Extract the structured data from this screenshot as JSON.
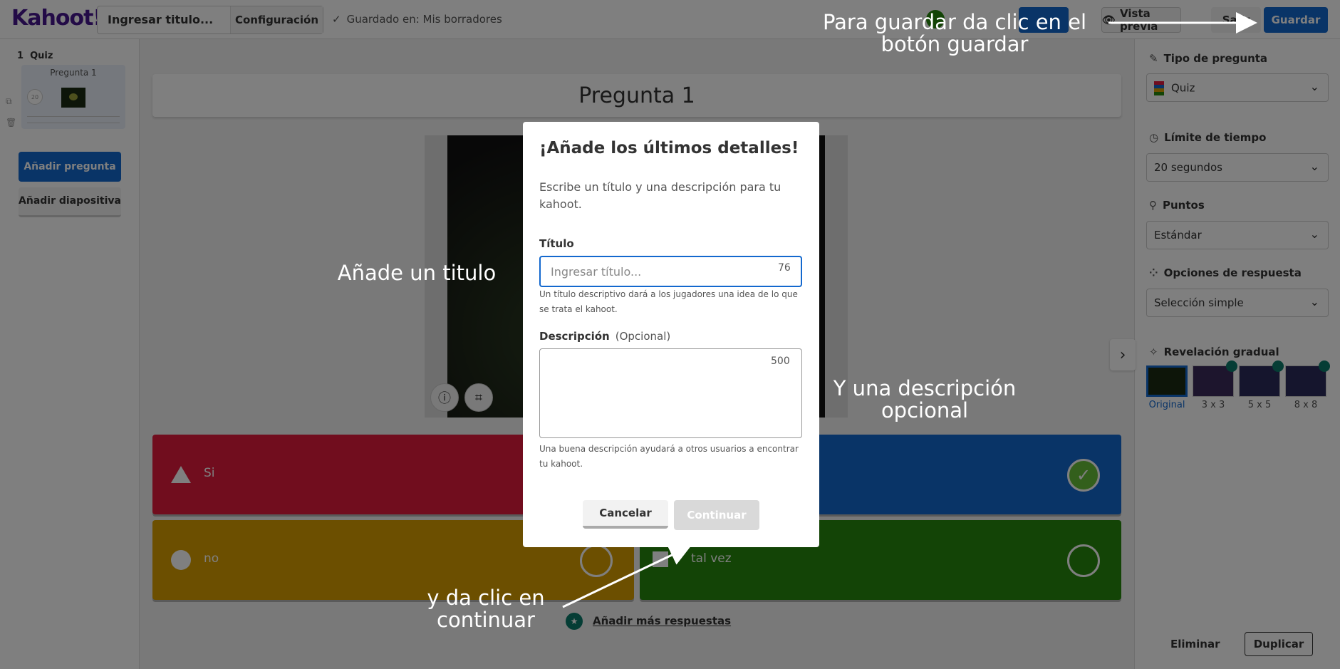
{
  "header": {
    "logo": "Kahoot!",
    "title_placeholder": "Ingresar titulo...",
    "config_label": "Configuración",
    "saved_status": "Guardado en: Mis borradores",
    "preview_label": "Vista previa",
    "exit_label": "Salir",
    "save_label": "Guardar"
  },
  "sidebar": {
    "question_number": "1",
    "question_type": "Quiz",
    "thumb_title": "Pregunta 1",
    "thumb_time": "20",
    "add_question": "Añadir pregunta",
    "add_slide": "Añadir diapositiva"
  },
  "editor": {
    "question_title": "Pregunta 1",
    "answers": [
      {
        "text": "Si",
        "color": "#e21b3c",
        "correct": false
      },
      {
        "text": "",
        "color": "#1368ce",
        "correct": true
      },
      {
        "text": "no",
        "color": "#d89e00",
        "correct": false
      },
      {
        "text": "tal vez",
        "color": "#26890c",
        "correct": false
      }
    ],
    "add_more_answers": "Añadir más respuestas"
  },
  "right_panel": {
    "question_type": {
      "label": "Tipo de pregunta",
      "value": "Quiz"
    },
    "time_limit": {
      "label": "Límite de tiempo",
      "value": "20 segundos"
    },
    "points": {
      "label": "Puntos",
      "value": "Estándar"
    },
    "answer_options": {
      "label": "Opciones de respuesta",
      "value": "Selección simple"
    },
    "reveal": {
      "label": "Revelación gradual",
      "options": [
        "Original",
        "3 x 3",
        "5 x 5",
        "8 x 8"
      ],
      "selected": "Original"
    },
    "delete_label": "Eliminar",
    "duplicate_label": "Duplicar"
  },
  "modal": {
    "title": "¡Añade los últimos detalles!",
    "description": "Escribe un título y una descripción para tu kahoot.",
    "title_label": "Título",
    "title_placeholder": "Ingresar título...",
    "title_counter": "76",
    "title_help": "Un título descriptivo dará a los jugadores una idea de lo que se trata el kahoot.",
    "description_label": "Descripción",
    "description_optional": "(Opcional)",
    "description_counter": "500",
    "description_help": "Una buena descripción ayudará a otros usuarios a encontrar tu kahoot.",
    "cancel_label": "Cancelar",
    "continue_label": "Continuar"
  },
  "annotations": {
    "save_hint_line1": "Para guardar da clic en el",
    "save_hint_line2": "botón guardar",
    "title_hint": "Añade un titulo",
    "desc_hint_line1": "Y una descripción",
    "desc_hint_line2": "opcional",
    "continue_hint_line1": "y da clic en",
    "continue_hint_line2": "continuar"
  }
}
